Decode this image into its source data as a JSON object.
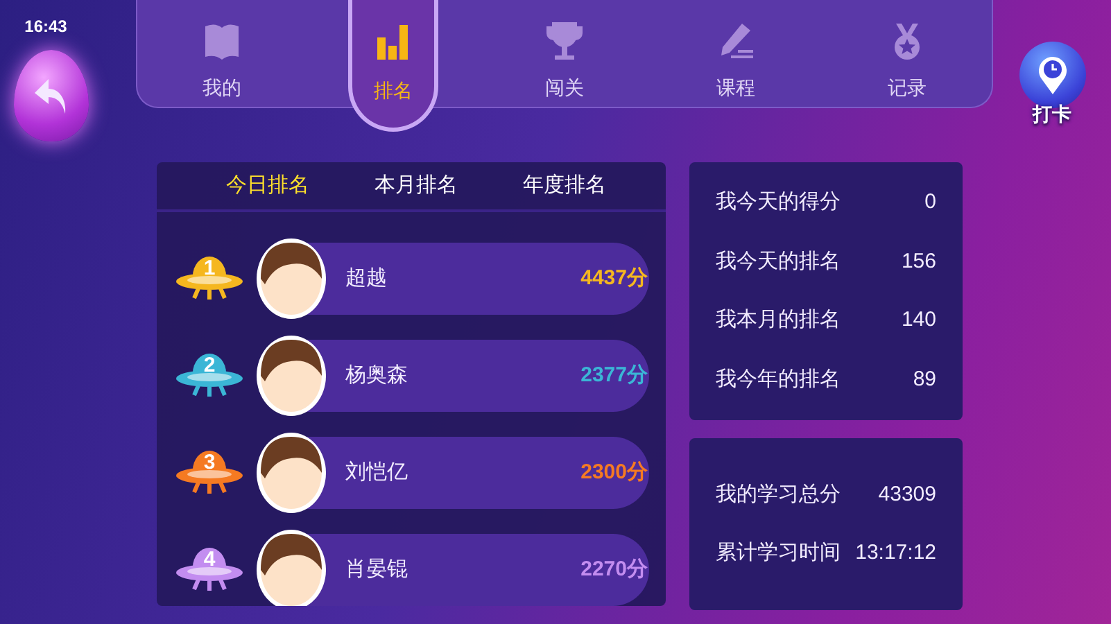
{
  "status_bar": {
    "time": "16:43"
  },
  "nav": [
    {
      "label": "我的",
      "kind": "book",
      "selected": false
    },
    {
      "label": "排名",
      "kind": "chart",
      "selected": true
    },
    {
      "label": "闯关",
      "kind": "trophy",
      "selected": false
    },
    {
      "label": "课程",
      "kind": "pencil",
      "selected": false
    },
    {
      "label": "记录",
      "kind": "medal",
      "selected": false
    }
  ],
  "checkin_button": {
    "label": "打卡"
  },
  "ranking_tabs": [
    {
      "label": "今日排名",
      "selected": true
    },
    {
      "label": "本月排名",
      "selected": false
    },
    {
      "label": "年度排名",
      "selected": false
    }
  ],
  "ranking": [
    {
      "rank": "1",
      "name": "超越",
      "score": "4437分",
      "color": "#f5b71f"
    },
    {
      "rank": "2",
      "name": "杨奥森",
      "score": "2377分",
      "color": "#3bb6d6"
    },
    {
      "rank": "3",
      "name": "刘恺亿",
      "score": "2300分",
      "color": "#f57a22"
    },
    {
      "rank": "4",
      "name": "肖晏锟",
      "score": "2270分",
      "color": "#c38df0"
    }
  ],
  "stats": [
    {
      "label": "我今天的得分",
      "value": "0"
    },
    {
      "label": "我今天的排名",
      "value": "156"
    },
    {
      "label": "我本月的排名",
      "value": "140"
    },
    {
      "label": "我今年的排名",
      "value": "89"
    }
  ],
  "totals": [
    {
      "label": "我的学习总分",
      "value": "43309"
    },
    {
      "label": "累计学习时间",
      "value": "13:17:12"
    }
  ]
}
